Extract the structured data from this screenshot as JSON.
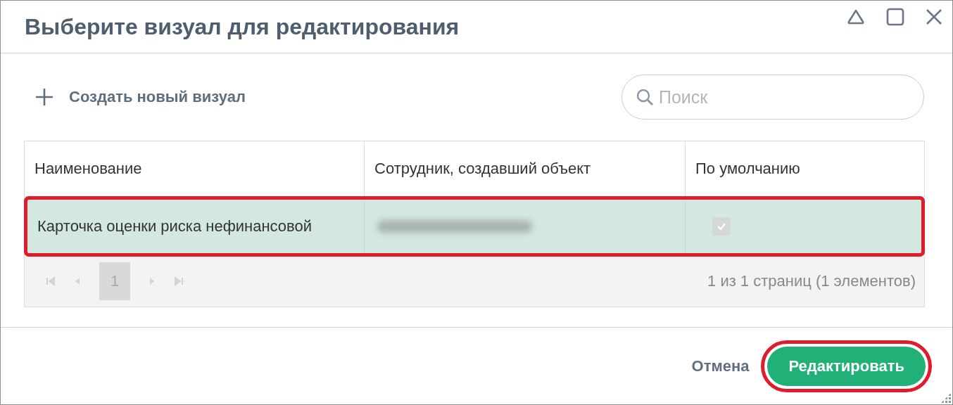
{
  "window": {
    "title": "Выберите визуал для редактирования"
  },
  "toolbar": {
    "create_label": "Создать новый визуал",
    "search": {
      "placeholder": "Поиск"
    }
  },
  "table": {
    "columns": [
      "Наименование",
      "Сотрудник, создавший объект",
      "По умолчанию"
    ],
    "rows": [
      {
        "name": "Карточка оценки риска нефинансовой",
        "author_redacted": true,
        "default_checked": true,
        "disabled": true,
        "selected": true,
        "highlighted": true
      }
    ]
  },
  "pager": {
    "pages": [
      {
        "label": "1",
        "selected": true
      }
    ],
    "summary": "1 из 1 страниц (1 элементов)"
  },
  "footer": {
    "buttons": [
      {
        "label": "Отмена",
        "kind": "link",
        "highlighted": false
      },
      {
        "label": "Редактировать",
        "kind": "primary",
        "highlighted": true
      }
    ]
  }
}
